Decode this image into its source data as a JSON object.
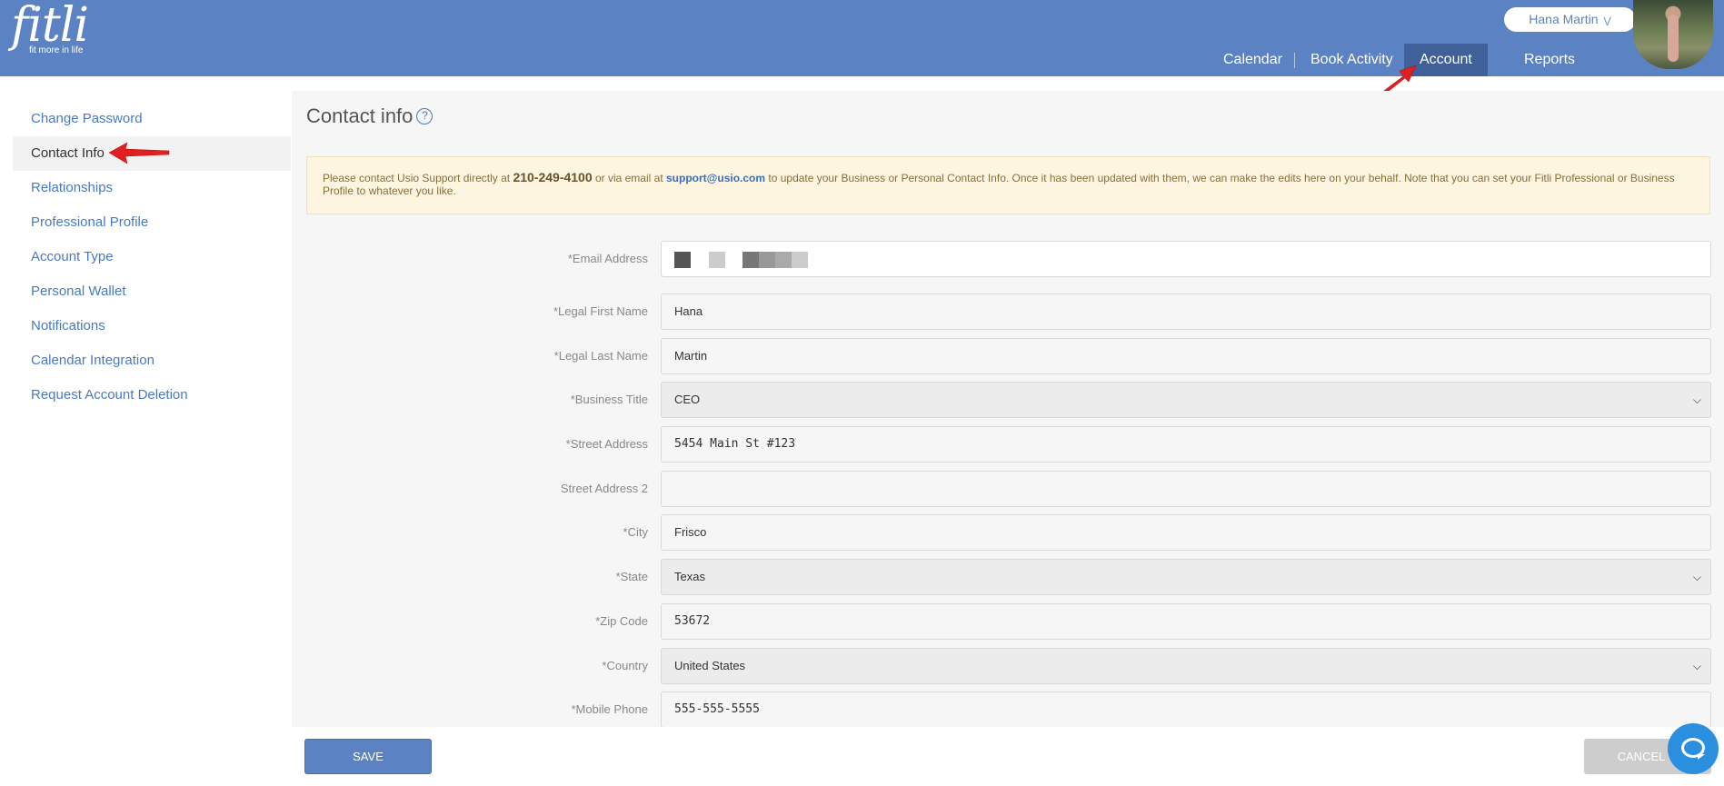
{
  "header": {
    "logo_word": "fitli",
    "logo_tagline": "fit more in life",
    "user_name": "Hana Martin",
    "nav": [
      "Calendar",
      "Book Activity",
      "Account",
      "Reports"
    ],
    "active_nav": "Account",
    "brand_color": "#5b82c2"
  },
  "sidebar": {
    "items": [
      {
        "label": "Change Password"
      },
      {
        "label": "Contact Info"
      },
      {
        "label": "Relationships"
      },
      {
        "label": "Professional Profile"
      },
      {
        "label": "Account Type"
      },
      {
        "label": "Personal Wallet"
      },
      {
        "label": "Notifications"
      },
      {
        "label": "Calendar Integration"
      },
      {
        "label": "Request Account Deletion"
      }
    ],
    "active": "Contact Info"
  },
  "main": {
    "title": "Contact info",
    "notice": {
      "part1": "Please contact Usio Support directly at ",
      "phone": "210-249-4100",
      "part2": " or via email at ",
      "email": "support@usio.com",
      "part3": " to update your Business or Personal Contact Info. Once it has been updated with them, we can make the edits here on your behalf. Note that you can set your Fitli Professional or Business Profile to whatever you like."
    },
    "form": {
      "email_label": "*Email Address",
      "first_name_label": "*Legal First Name",
      "first_name": "Hana",
      "last_name_label": "*Legal Last Name",
      "last_name": "Martin",
      "title_label": "*Business Title",
      "title": "CEO",
      "street_label": "*Street Address",
      "street": "5454 Main St #123",
      "street2_label": "Street Address 2",
      "street2": "",
      "city_label": "*City",
      "city": "Frisco",
      "state_label": "*State",
      "state": "Texas",
      "zip_label": "*Zip Code",
      "zip": "53672",
      "country_label": "*Country",
      "country": "United States",
      "phone_label": "*Mobile Phone",
      "phone": "555-555-5555"
    },
    "save_label": "SAVE",
    "cancel_label": "CANCEL"
  }
}
